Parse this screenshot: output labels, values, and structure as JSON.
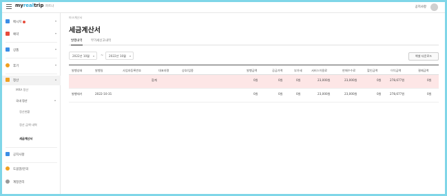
{
  "header": {
    "logo_prefix": "my",
    "logo_mid": "real",
    "logo_suffix": "trip",
    "nav_label": "파트너",
    "username": "공지사항"
  },
  "sidebar": {
    "items": [
      {
        "label": "메시지",
        "icon": "message-icon",
        "color": "#3a8ee6",
        "has_dot": true
      },
      {
        "label": "예약",
        "icon": "calendar-icon",
        "color": "#e74c3c"
      },
      {
        "label": "상품",
        "icon": "product-icon",
        "color": "#3a8ee6"
      },
      {
        "label": "후기",
        "icon": "review-icon",
        "color": "#f0a020"
      },
      {
        "label": "정산",
        "icon": "settlement-icon",
        "color": "#f0a020"
      }
    ],
    "settlement_subs": {
      "first": "MRA 정산",
      "group": "국내 정산",
      "children": [
        "정산현황",
        "정산 금액 내역",
        "세금계산서"
      ]
    },
    "bottom_items": [
      {
        "label": "공지사항",
        "icon": "megaphone-icon",
        "color": "#3a8ee6"
      },
      {
        "label": "도움말/문의",
        "icon": "help-icon",
        "color": "#f0a020"
      },
      {
        "label": "계정관리",
        "icon": "account-icon",
        "color": "#999999"
      }
    ]
  },
  "main": {
    "breadcrumb": "마크계산서",
    "title": "세금계산서",
    "tabs": [
      "발행내역",
      "부가세신고내역"
    ],
    "filters": {
      "from": "2022년 10월",
      "tilde": "~",
      "to": "2022년 10월"
    },
    "excel_button": "엑셀 다운로드",
    "columns": [
      "발행상태",
      "발행일",
      "사업자등록번호",
      "대표자명",
      "상호/업종",
      "발행금액",
      "공급가액",
      "부가세",
      "서비스이용료",
      "판매수수료",
      "할인금액",
      "이익금액",
      "결제금액"
    ],
    "summary_row": {
      "label": "합계",
      "values": [
        "0원",
        "0원",
        "0원",
        "23,000원",
        "23,000원",
        "0원",
        "278,677원",
        "0원"
      ]
    },
    "data_row": {
      "status": "발행대기",
      "date": "2022-10-31",
      "values": [
        "0원",
        "0원",
        "0원",
        "23,000원",
        "23,000원",
        "0원",
        "278,677원",
        "0원"
      ]
    }
  }
}
